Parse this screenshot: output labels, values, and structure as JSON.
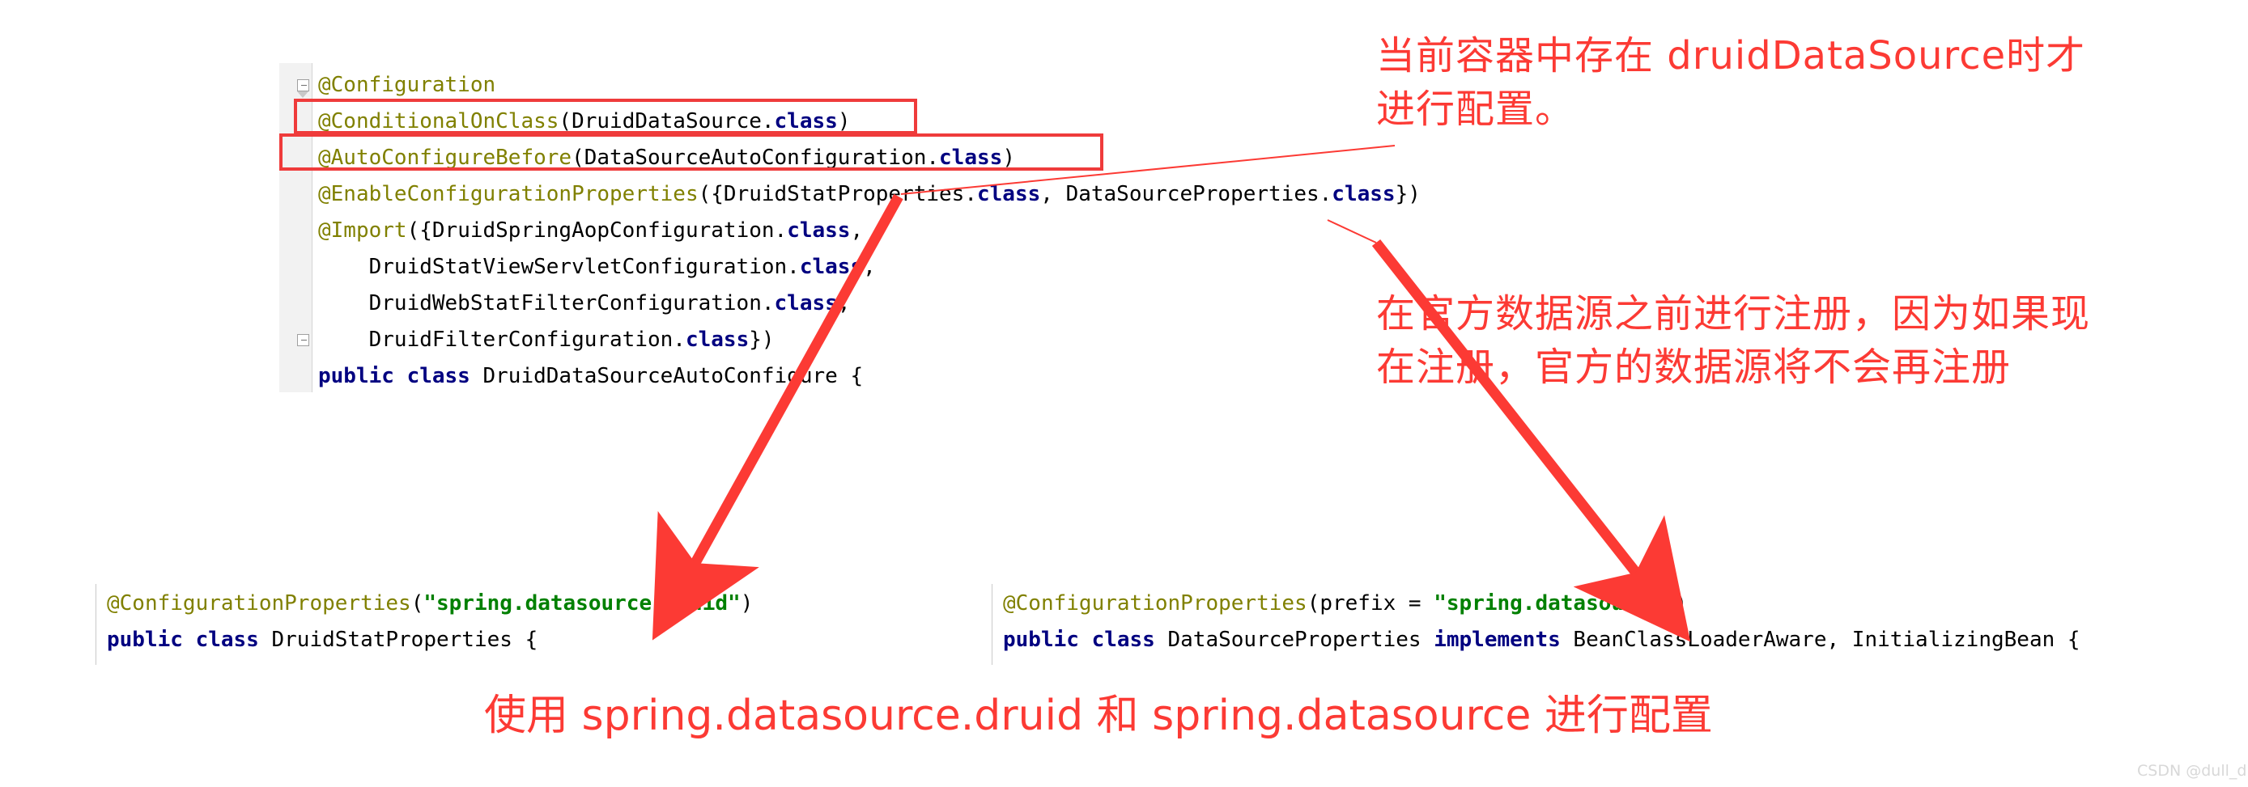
{
  "top_code": {
    "lines": [
      [
        {
          "t": "@Configuration",
          "c": "ann"
        }
      ],
      [
        {
          "t": "@ConditionalOnClass",
          "c": "ann"
        },
        {
          "t": "(DruidDataSource.",
          "c": "plain"
        },
        {
          "t": "class",
          "c": "kw"
        },
        {
          "t": ")",
          "c": "plain"
        }
      ],
      [
        {
          "t": "@AutoConfigureBefore",
          "c": "ann"
        },
        {
          "t": "(DataSourceAutoConfiguration.",
          "c": "plain"
        },
        {
          "t": "class",
          "c": "kw"
        },
        {
          "t": ")",
          "c": "plain"
        }
      ],
      [
        {
          "t": "@EnableConfigurationProperties",
          "c": "ann"
        },
        {
          "t": "({DruidStatProperties.",
          "c": "plain"
        },
        {
          "t": "class",
          "c": "kw"
        },
        {
          "t": ", DataSourceProperties.",
          "c": "plain"
        },
        {
          "t": "class",
          "c": "kw"
        },
        {
          "t": "})",
          "c": "plain"
        }
      ],
      [
        {
          "t": "@Import",
          "c": "ann"
        },
        {
          "t": "({DruidSpringAopConfiguration.",
          "c": "plain"
        },
        {
          "t": "class",
          "c": "kw"
        },
        {
          "t": ",",
          "c": "plain"
        }
      ],
      [
        {
          "t": "    DruidStatViewServletConfiguration.",
          "c": "plain"
        },
        {
          "t": "class",
          "c": "kw"
        },
        {
          "t": ",",
          "c": "plain"
        }
      ],
      [
        {
          "t": "    DruidWebStatFilterConfiguration.",
          "c": "plain"
        },
        {
          "t": "class",
          "c": "kw"
        },
        {
          "t": ",",
          "c": "plain"
        }
      ],
      [
        {
          "t": "    DruidFilterConfiguration.",
          "c": "plain"
        },
        {
          "t": "class",
          "c": "kw"
        },
        {
          "t": "})",
          "c": "plain"
        }
      ],
      [
        {
          "t": "public class",
          "c": "kw"
        },
        {
          "t": " DruidDataSourceAutoConfigure {",
          "c": "plain"
        }
      ]
    ]
  },
  "bottom_left_code": {
    "lines": [
      [
        {
          "t": "@ConfigurationProperties",
          "c": "ann"
        },
        {
          "t": "(",
          "c": "plain"
        },
        {
          "t": "\"spring.datasource.druid\"",
          "c": "str"
        },
        {
          "t": ")",
          "c": "plain"
        }
      ],
      [
        {
          "t": "public class",
          "c": "kw"
        },
        {
          "t": " DruidStatProperties {",
          "c": "plain"
        }
      ]
    ]
  },
  "bottom_right_code": {
    "lines": [
      [
        {
          "t": "@ConfigurationProperties",
          "c": "ann"
        },
        {
          "t": "(prefix = ",
          "c": "plain"
        },
        {
          "t": "\"spring.datasource\"",
          "c": "str"
        },
        {
          "t": ")",
          "c": "plain"
        }
      ],
      [
        {
          "t": "public class",
          "c": "kw"
        },
        {
          "t": " DataSourceProperties ",
          "c": "plain"
        },
        {
          "t": "implements",
          "c": "kw"
        },
        {
          "t": " BeanClassLoaderAware, InitializingBean {",
          "c": "plain"
        }
      ]
    ]
  },
  "annotations": {
    "note_conditional": "当前容器中存在 druidDataSource时才\n进行配置。",
    "note_autoconfigure": "在官方数据源之前进行注册，因为如果现\n在注册，官方的数据源将不会再注册",
    "caption_bottom": "使用 spring.datasource.druid 和 spring.datasource 进行配置"
  },
  "watermark": {
    "text": "CSDN @dull_dull"
  },
  "colors": {
    "accent_red": "#fc3a34",
    "box_red": "#ef3b3b",
    "annotation_olive": "#808000",
    "keyword_navy": "#000080",
    "string_green": "#008000",
    "gutter_gray": "#f2f2f2",
    "watermark_gray": "#d8d8d8"
  }
}
